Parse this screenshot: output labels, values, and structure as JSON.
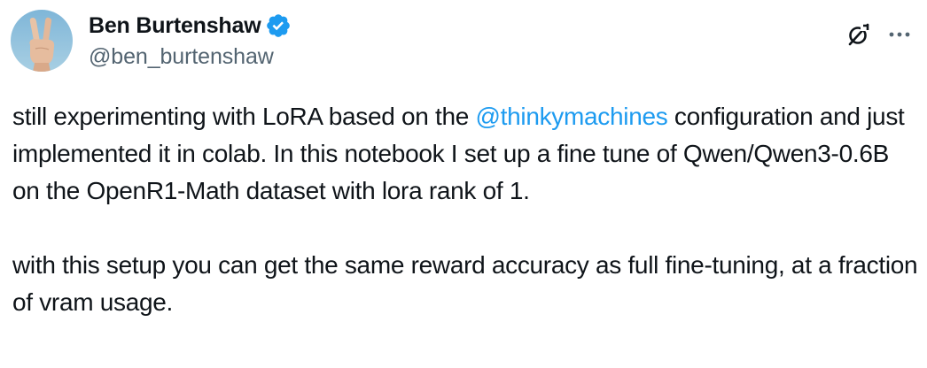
{
  "author": {
    "display_name": "Ben Burtenshaw",
    "handle": "@ben_burtenshaw",
    "verified_icon": "verified-badge-icon",
    "avatar_icon": "peace-sign-hand-avatar"
  },
  "actions": {
    "grok_icon": "grok-icon",
    "more_icon": "more-options-icon"
  },
  "tweet": {
    "p1_before_mention": "still experimenting with LoRA based on the ",
    "mention": "@thinkymachines",
    "p1_after_mention": " configuration and just implemented it in colab. In this notebook I set up a fine tune of Qwen/Qwen3-0.6B on the OpenR1-Math dataset with lora rank of 1.",
    "p2": "with this setup you can get the same reward accuracy as full fine-tuning, at a fraction of vram usage."
  },
  "colors": {
    "text": "#0f1419",
    "secondary": "#536471",
    "accent": "#1d9bf0"
  }
}
